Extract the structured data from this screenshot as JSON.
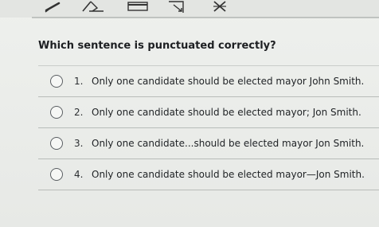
{
  "question": "Which sentence is punctuated correctly?",
  "options": [
    {
      "number": "1.",
      "text": "Only one candidate should be elected mayor John Smith."
    },
    {
      "number": "2.",
      "text": "Only one candidate should be elected mayor; Jon Smith."
    },
    {
      "number": "3.",
      "text": "Only one candidate...should be elected mayor Jon Smith."
    },
    {
      "number": "4.",
      "text": "Only one candidate should be elected mayor—Jon Smith."
    }
  ],
  "toolbar": {
    "icons": [
      "pencil-icon",
      "eraser-icon",
      "highlighter-icon",
      "expand-icon",
      "cross-out-icon"
    ]
  }
}
